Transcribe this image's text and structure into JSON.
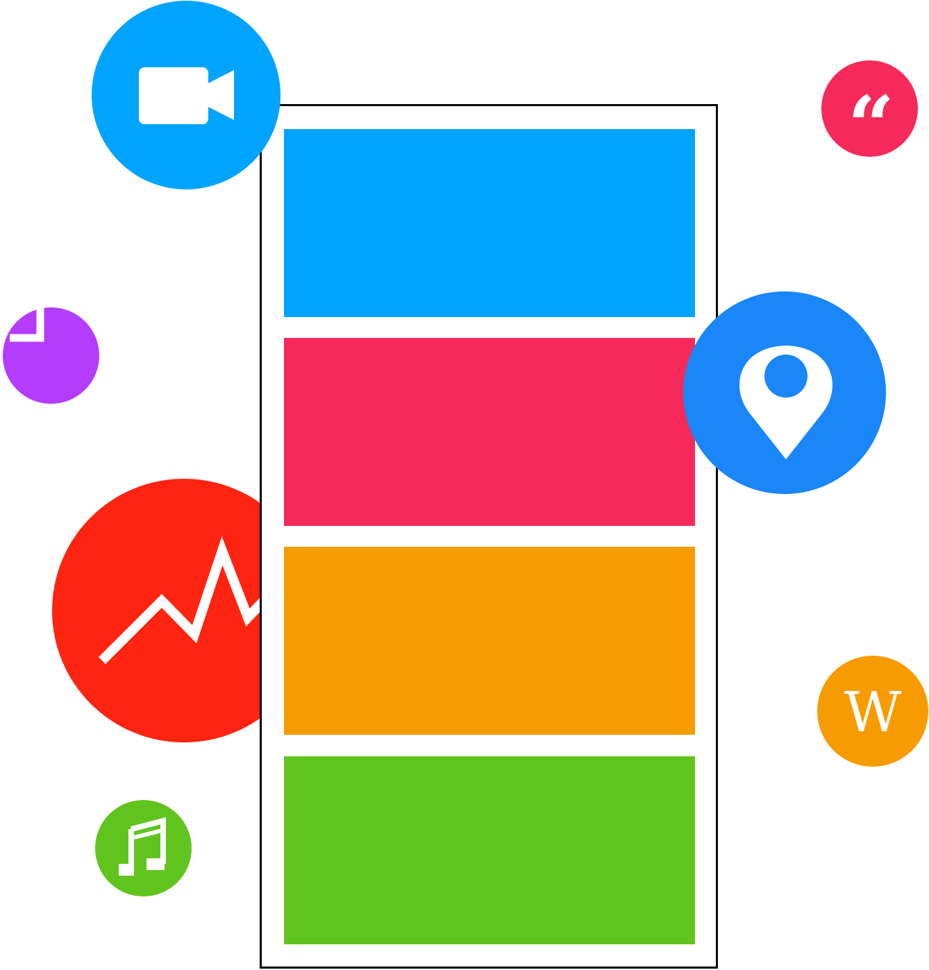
{
  "colors": {
    "blue": "#00a4fd",
    "pink": "#f52a5b",
    "orange": "#f79b02",
    "green": "#61c41e",
    "red": "#fd2512",
    "purple": "#b33cfd",
    "pin_blue": "#1a86f7",
    "wiki_orange": "#f79b02",
    "quote_pink": "#f52a5b",
    "music_green": "#61c41e",
    "frame": "#000000"
  },
  "phone": {
    "blocks": [
      {
        "color": "#00a4fd"
      },
      {
        "color": "#f52a5b"
      },
      {
        "color": "#f79b02"
      },
      {
        "color": "#61c41e"
      }
    ]
  },
  "icons": {
    "video": "video-camera-icon",
    "clock": "clock-icon",
    "chart": "line-chart-icon",
    "music": "music-note-icon",
    "quote": "quote-icon",
    "pin": "location-pin-icon",
    "wiki": "wikipedia-icon"
  },
  "labels": {
    "wiki_letter": "W",
    "quote_mark": "“"
  }
}
